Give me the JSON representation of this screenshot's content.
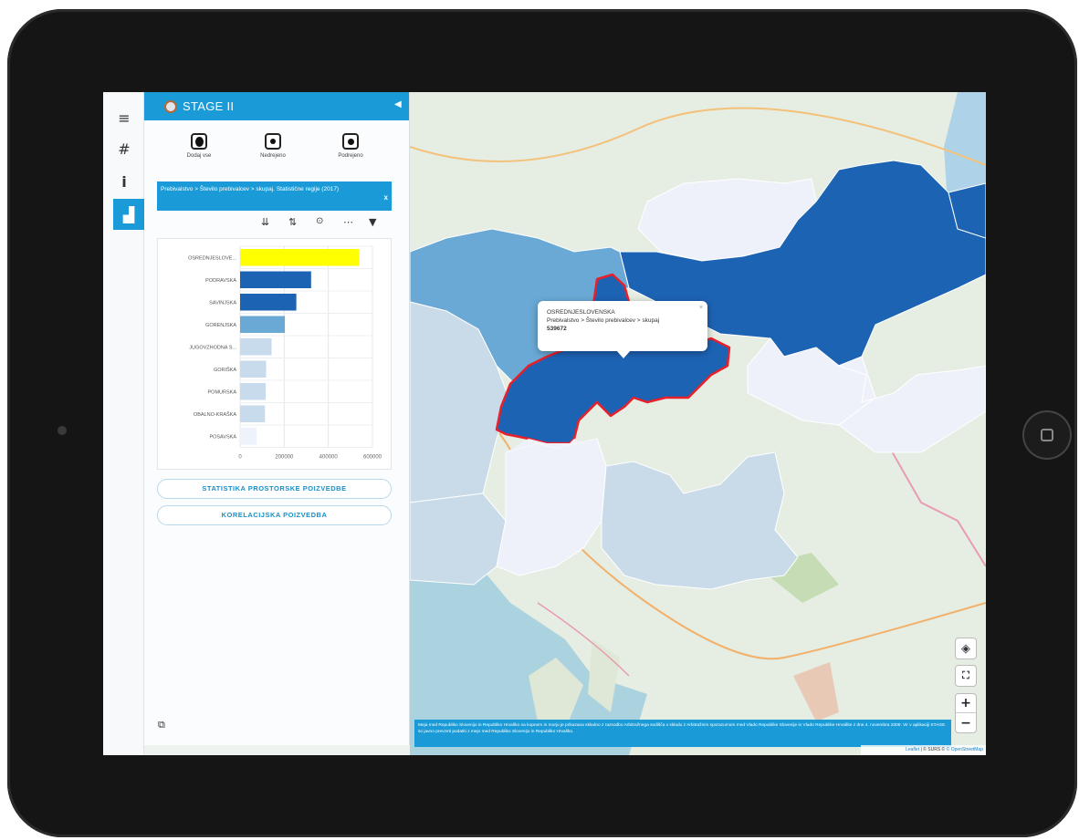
{
  "app": {
    "title": "STAGE II"
  },
  "rail": {
    "items": [
      {
        "name": "menu",
        "glyph": "≡"
      },
      {
        "name": "grid",
        "glyph": "#"
      },
      {
        "name": "info",
        "glyph": "i"
      },
      {
        "name": "chart",
        "glyph": "▟"
      }
    ]
  },
  "modes": [
    {
      "label": "Dodaj vse"
    },
    {
      "label": "Nedrejeno"
    },
    {
      "label": "Podrejeno"
    }
  ],
  "query": {
    "text": "Prebivalstvo > Število prebivalcev > skupaj. Statistične regije (2017)",
    "close_label": "x"
  },
  "chart_toolbar": {
    "icons": [
      "sort-desc-icon",
      "sort-asc-icon",
      "reset-icon",
      "more-icon",
      "filter-icon"
    ]
  },
  "chart_data": {
    "type": "bar",
    "orientation": "horizontal",
    "categories": [
      "OSREDNJESLOVE...",
      "PODRAVSKA",
      "SAVINJSKA",
      "GORENJSKA",
      "JUGOVZHODNA S...",
      "GORIŠKA",
      "POMURSKA",
      "OBALNO-KRAŠKA",
      "POSAVSKA"
    ],
    "values": [
      539672,
      322000,
      255000,
      203000,
      143000,
      118000,
      116000,
      113000,
      75000
    ],
    "colors": [
      "#ffff00",
      "#1d63b4",
      "#1d63b4",
      "#6aa9d6",
      "#c7dbec",
      "#c7dbec",
      "#c7dbec",
      "#c7dbec",
      "#eef2fa"
    ],
    "xticks": [
      "0",
      "200000",
      "400000",
      "600000"
    ],
    "xlim": [
      0,
      600000
    ]
  },
  "buttons": {
    "spatial_stats": "STATISTIKA PROSTORSKE POIZVEDBE",
    "correlation": "KORELACIJSKA POIZVEDBA"
  },
  "popup": {
    "region": "OSREDNJESLOVENSKA",
    "attribute": "Prebivalstvo > Število prebivalcev > skupaj",
    "value": "539672",
    "close": "×"
  },
  "map": {
    "disclaimer": "Meja med Republiko Slovenijo in Republiko Hrvaško na kopnem in morju je prikazana skladno z razsodbo Arbitražnega sodišča v skladu z Arbitražnim sporazumom med Vlado Republike Slovenije in Vlado Republike Hrvaške z dne 4. novembra 2009. Vir v aplikaciji STAGE so javno prevzeti podatki z mejo med Republiko Slovenijo in Republiko Hrvaško.",
    "attribution_leaflet": "Leaflet",
    "attribution_osm": "© OpenStreetMap",
    "attribution_sep": " | © SURS © ",
    "zoom_in": "+",
    "zoom_out": "−",
    "colors": {
      "dark": "#1d63b4",
      "medium": "#6aa9d6",
      "light": "#c9dbe9",
      "pale": "#eef1fa",
      "highlight": "#e8202a"
    }
  }
}
